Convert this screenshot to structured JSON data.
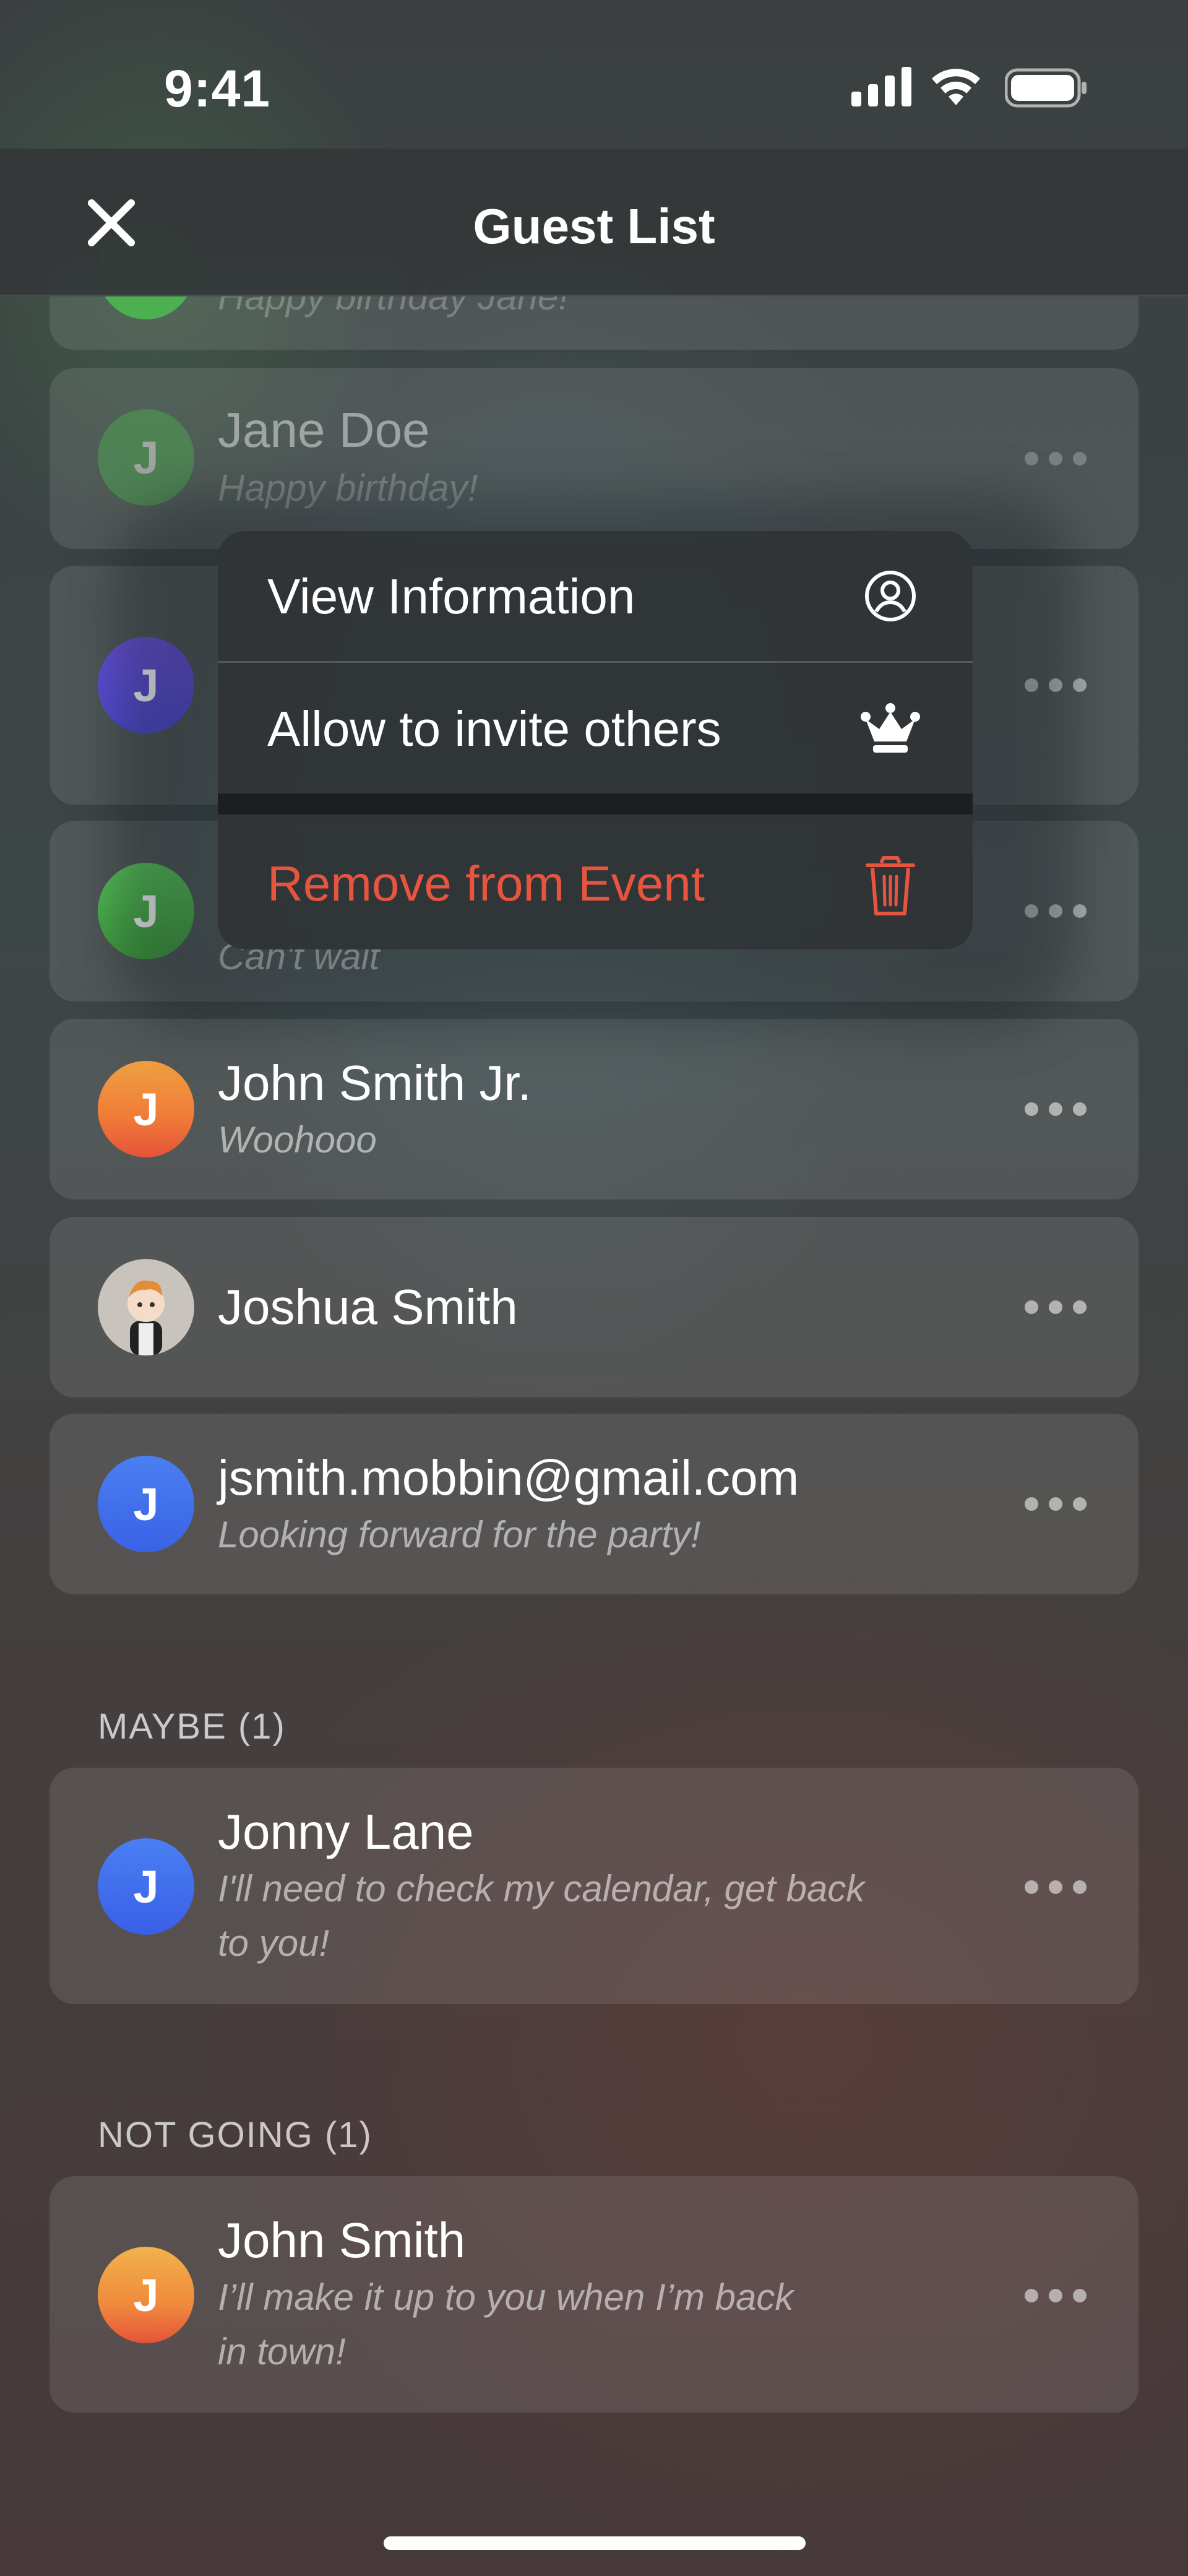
{
  "status_bar": {
    "time": "9:41"
  },
  "header": {
    "title": "Guest List"
  },
  "context_menu": {
    "items": [
      {
        "label": "View Information",
        "icon": "person-circle-icon"
      },
      {
        "label": "Allow to invite others",
        "icon": "crown-icon"
      },
      {
        "label": "Remove from Event",
        "icon": "trash-icon",
        "destructive": true
      }
    ]
  },
  "guests_going_partial": [
    {
      "name": "",
      "note": "Happy birthday Jane!",
      "avatar_letter": "",
      "avatar_color": "#4caf50"
    },
    {
      "name": "Jane Doe",
      "note": "Happy birthday!",
      "avatar_letter": "J",
      "avatar_color": "#4caf50"
    },
    {
      "name": "",
      "note": "",
      "avatar_letter": "J",
      "avatar_color": "#5a4ad9"
    },
    {
      "name": "",
      "note": "Can't wait",
      "avatar_letter": "J",
      "avatar_color": "#4cbb4a"
    },
    {
      "name": "John Smith Jr.",
      "note": "Woohooo",
      "avatar_letter": "J",
      "avatar_color": "#f08a3c"
    },
    {
      "name": "Joshua Smith",
      "note": "",
      "avatar_letter": "",
      "avatar_color": "#bbbbbb"
    },
    {
      "name": "jsmith.mobbin@gmail.com",
      "note": "Looking forward for the party!",
      "avatar_letter": "J",
      "avatar_color": "#3d72f0"
    }
  ],
  "sections": {
    "maybe": {
      "label": "MAYBE (1)",
      "guests": [
        {
          "name": "Jonny Lane",
          "note_line1": "I'll need to check my calendar, get back",
          "note_line2": "to you!",
          "avatar_letter": "J",
          "avatar_color": "#3d6cf0"
        }
      ]
    },
    "not_going": {
      "label": "NOT GOING (1)",
      "guests": [
        {
          "name": "John Smith",
          "note_line1": "I’ll make it up to you when I’m back",
          "note_line2": "in town!",
          "avatar_letter": "J",
          "avatar_color": "#f0a040"
        }
      ]
    }
  }
}
